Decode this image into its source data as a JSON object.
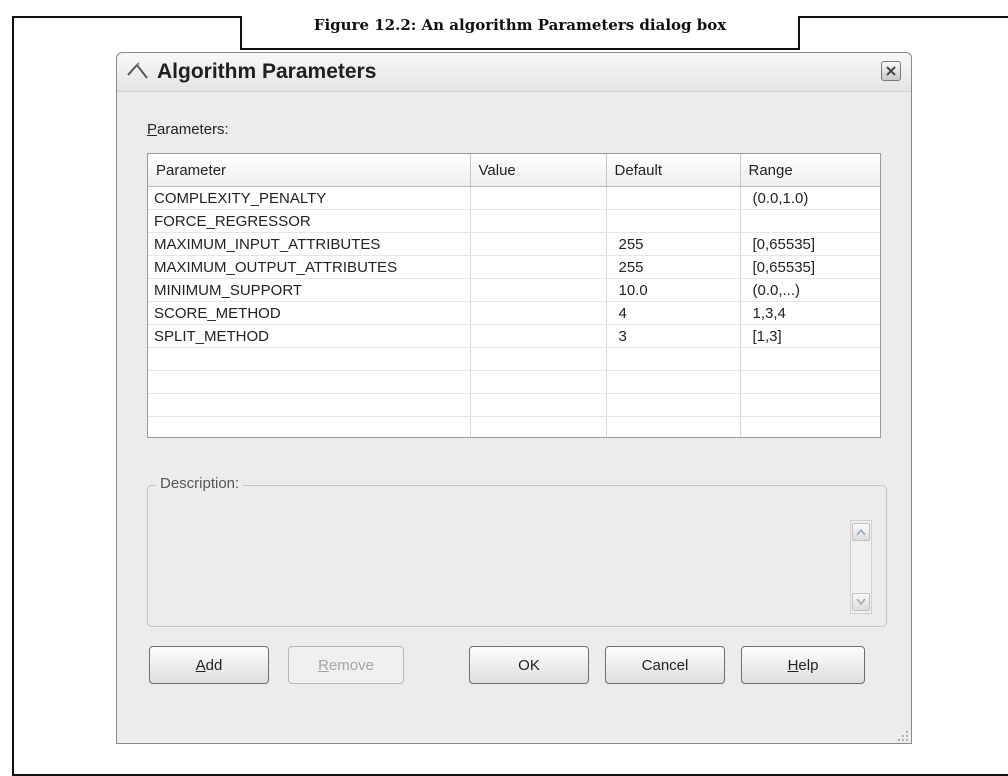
{
  "figure": {
    "caption": "Figure 12.2: An algorithm Parameters dialog box"
  },
  "dialog": {
    "title": "Algorithm Parameters",
    "parameters_label_accel": "P",
    "parameters_label_rest": "arameters:",
    "columns": [
      "Parameter",
      "Value",
      "Default",
      "Range"
    ],
    "rows": [
      {
        "parameter": "COMPLEXITY_PENALTY",
        "value": "",
        "default": "",
        "range": "(0.0,1.0)"
      },
      {
        "parameter": "FORCE_REGRESSOR",
        "value": "",
        "default": "",
        "range": ""
      },
      {
        "parameter": "MAXIMUM_INPUT_ATTRIBUTES",
        "value": "",
        "default": "255",
        "range": "[0,65535]"
      },
      {
        "parameter": "MAXIMUM_OUTPUT_ATTRIBUTES",
        "value": "",
        "default": "255",
        "range": "[0,65535]"
      },
      {
        "parameter": "MINIMUM_SUPPORT",
        "value": "",
        "default": "10.0",
        "range": "(0.0,...)"
      },
      {
        "parameter": "SCORE_METHOD",
        "value": "",
        "default": "4",
        "range": "1,3,4"
      },
      {
        "parameter": "SPLIT_METHOD",
        "value": "",
        "default": "3",
        "range": "[1,3]"
      },
      {
        "parameter": "",
        "value": "",
        "default": "",
        "range": ""
      },
      {
        "parameter": "",
        "value": "",
        "default": "",
        "range": ""
      },
      {
        "parameter": "",
        "value": "",
        "default": "",
        "range": ""
      },
      {
        "parameter": "",
        "value": "",
        "default": "",
        "range": ""
      }
    ],
    "description_label": "Description:",
    "description_text": "",
    "buttons": {
      "add_accel": "A",
      "add_rest": "dd",
      "remove_accel": "R",
      "remove_rest": "emove",
      "ok": "OK",
      "cancel": "Cancel",
      "help_accel": "H",
      "help_rest": "elp"
    },
    "icons": {
      "title": "wand-icon",
      "close": "close-icon",
      "scroll_up": "scroll-up-arrow-icon",
      "scroll_down": "scroll-down-arrow-icon",
      "resize": "resize-grip-icon"
    }
  }
}
